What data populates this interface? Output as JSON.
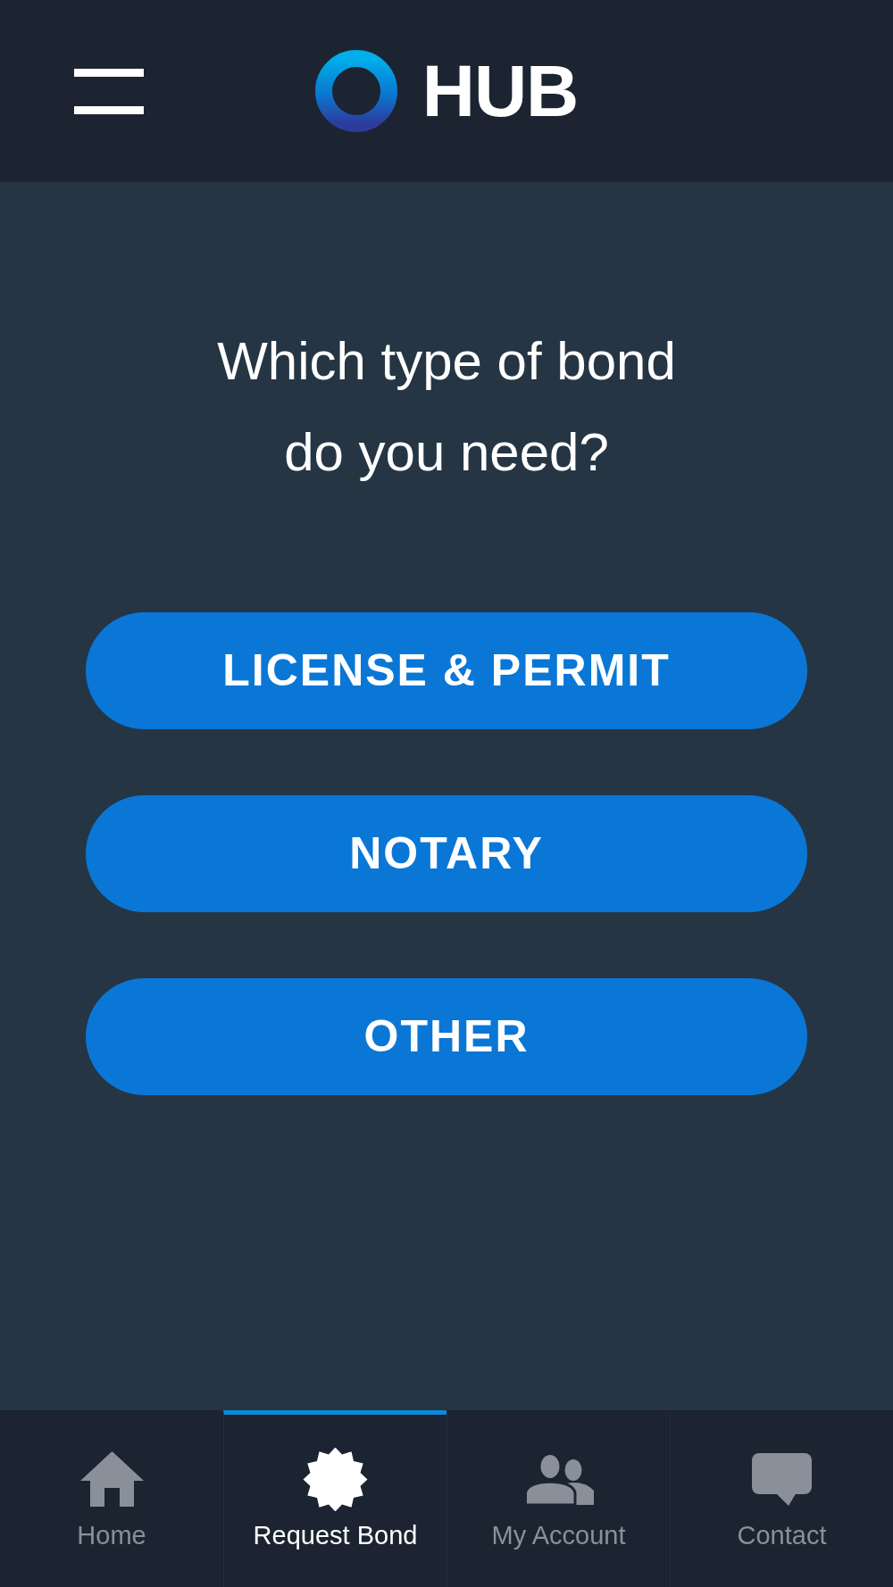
{
  "header": {
    "logo_text": "HUB"
  },
  "question": "Which type of bond do you need?",
  "options": [
    {
      "label": "LICENSE & PERMIT"
    },
    {
      "label": "NOTARY"
    },
    {
      "label": "OTHER"
    }
  ],
  "tab_bar": {
    "tabs": [
      {
        "label": "Home",
        "kind": "home",
        "selected": false
      },
      {
        "label": "Request Bond",
        "kind": "starburst",
        "selected": true
      },
      {
        "label": "My Account",
        "kind": "people",
        "selected": false
      },
      {
        "label": "Contact",
        "kind": "chat",
        "selected": false
      }
    ]
  }
}
